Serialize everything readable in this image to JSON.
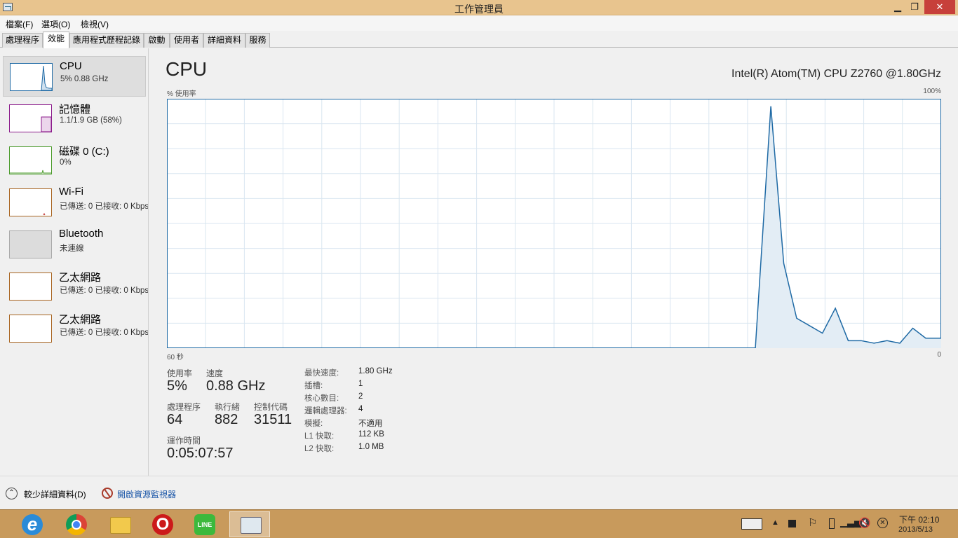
{
  "window": {
    "title": "工作管理員",
    "min_glyph": "▁",
    "max_glyph": "❐",
    "close_glyph": "✕"
  },
  "menu": [
    "檔案(F)",
    "選項(O)",
    "檢視(V)"
  ],
  "tabs": [
    "處理程序",
    "效能",
    "應用程式歷程記錄",
    "啟動",
    "使用者",
    "詳細資料",
    "服務"
  ],
  "active_tab": "效能",
  "sidebar": {
    "items": [
      {
        "name": "CPU",
        "sub": "5% 0.88 GHz",
        "color": "#1f6aa5",
        "selected": true
      },
      {
        "name": "記憶體",
        "sub": "1.1/1.9 GB (58%)",
        "color": "#8b1a8b"
      },
      {
        "name": "磁碟 0 (C:)",
        "sub": "0%",
        "color": "#4a9a2a"
      },
      {
        "name": "Wi-Fi",
        "sub": "已傳送: 0 已接收: 0 Kbps",
        "color": "#a86420"
      },
      {
        "name": "Bluetooth",
        "sub": "未連線",
        "color": "#aaaaaa"
      },
      {
        "name": "乙太網路",
        "sub": "已傳送: 0 已接收: 0 Kbps",
        "color": "#a86420"
      },
      {
        "name": "乙太網路",
        "sub": "已傳送: 0 已接收: 0 Kbps",
        "color": "#a86420"
      }
    ]
  },
  "main": {
    "title": "CPU",
    "processor": "Intel(R) Atom(TM) CPU Z2760 @1.80GHz",
    "y_label": "% 使用率",
    "y_max_label": "100%",
    "x_left_label": "60 秒",
    "x_right_label": "0",
    "stats": {
      "usage_label": "使用率",
      "usage_value": "5%",
      "speed_label": "速度",
      "speed_value": "0.88 GHz",
      "processes_label": "處理程序",
      "processes_value": "64",
      "threads_label": "執行緒",
      "threads_value": "882",
      "handles_label": "控制代碼",
      "handles_value": "31511",
      "uptime_label": "運作時間",
      "uptime_value": "0:05:07:57"
    },
    "specs": [
      {
        "key": "最快速度:",
        "value": "1.80 GHz"
      },
      {
        "key": "插槽:",
        "value": "1"
      },
      {
        "key": "核心數目:",
        "value": "2"
      },
      {
        "key": "邏輯處理器:",
        "value": "4"
      },
      {
        "key": "模擬:",
        "value": "不適用"
      },
      {
        "key": "L1 快取:",
        "value": "112 KB"
      },
      {
        "key": "L2 快取:",
        "value": "1.0 MB"
      }
    ]
  },
  "chart_data": {
    "type": "area",
    "x_range": [
      60,
      0
    ],
    "ylim": [
      0,
      100
    ],
    "grid": true,
    "color": "#1f6aa5",
    "points": [
      {
        "seconds_ago": 60,
        "value": 0
      },
      {
        "seconds_ago": 14.4,
        "value": 0
      },
      {
        "seconds_ago": 13.2,
        "value": 97
      },
      {
        "seconds_ago": 12.2,
        "value": 34
      },
      {
        "seconds_ago": 11.2,
        "value": 12
      },
      {
        "seconds_ago": 10.2,
        "value": 9
      },
      {
        "seconds_ago": 9.2,
        "value": 6
      },
      {
        "seconds_ago": 8.2,
        "value": 16
      },
      {
        "seconds_ago": 7.2,
        "value": 3
      },
      {
        "seconds_ago": 6.2,
        "value": 3
      },
      {
        "seconds_ago": 5.2,
        "value": 2
      },
      {
        "seconds_ago": 4.2,
        "value": 3
      },
      {
        "seconds_ago": 3.2,
        "value": 2
      },
      {
        "seconds_ago": 2.2,
        "value": 8
      },
      {
        "seconds_ago": 1.2,
        "value": 4
      },
      {
        "seconds_ago": 0,
        "value": 4
      }
    ]
  },
  "footer": {
    "fewer_details": "較少詳細資料(D)",
    "resource_monitor": "開啟資源監視器"
  },
  "taskbar": {
    "apps": [
      "ie-icon",
      "chrome-icon",
      "file-explorer-icon",
      "opera-icon",
      "line-icon",
      "task-manager-icon"
    ],
    "line_label": "LINE",
    "opera_label": "O",
    "ie_label": "e",
    "time": "下午 02:10",
    "date": "2013/5/13"
  }
}
